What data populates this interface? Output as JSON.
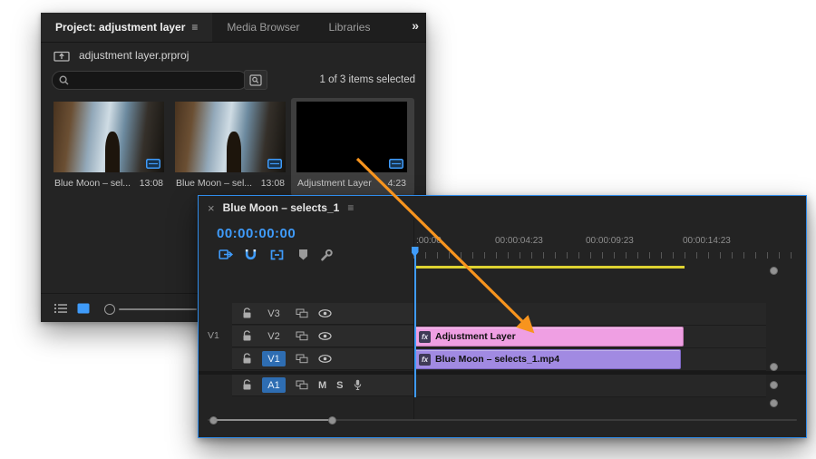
{
  "colors": {
    "accent_blue": "#3f9bfa",
    "target_track_blue": "#2e6db2",
    "adjustment_clip_pink": "#ef9fe3",
    "video_clip_purple": "#a18ae2",
    "work_area_yellow": "#ddd231",
    "drag_arrow_orange": "#f7941e",
    "panel_bg": "#242424"
  },
  "project": {
    "tabs": [
      {
        "label": "Project: adjustment layer",
        "active": true
      },
      {
        "label": "Media Browser",
        "active": false
      },
      {
        "label": "Libraries",
        "active": false
      }
    ],
    "tab_menu_glyph": "≡",
    "overflow_glyph": "»",
    "bin_name": "adjustment layer.prproj",
    "search": {
      "value": ""
    },
    "status": "1 of 3 items selected",
    "items": [
      {
        "name": "Blue Moon – sel...",
        "duration": "13:08",
        "selected": false
      },
      {
        "name": "Blue Moon – sel...",
        "duration": "13:08",
        "selected": false
      },
      {
        "name": "Adjustment Layer",
        "duration": "4:23",
        "selected": true
      }
    ]
  },
  "timeline": {
    "close_glyph": "×",
    "title": "Blue Moon – selects_1",
    "menu_glyph": "≡",
    "timecode": "00:00:00:00",
    "ruler_labels": [
      ":00:00",
      "00:00:04:23",
      "00:00:09:23",
      "00:00:14:23"
    ],
    "tracks": {
      "video": [
        {
          "source_patch": "",
          "name": "V3",
          "targeted": false
        },
        {
          "source_patch": "V1",
          "name": "V2",
          "targeted": false
        },
        {
          "source_patch": "",
          "name": "V1",
          "targeted": true
        }
      ],
      "audio": [
        {
          "source_patch": "",
          "name": "A1",
          "targeted": true,
          "mute_label": "M",
          "solo_label": "S"
        }
      ]
    },
    "clips": [
      {
        "track": "V2",
        "label": "Adjustment Layer",
        "badge": "fx"
      },
      {
        "track": "V1",
        "label": "Blue Moon – selects_1.mp4",
        "badge": "fx"
      }
    ]
  }
}
